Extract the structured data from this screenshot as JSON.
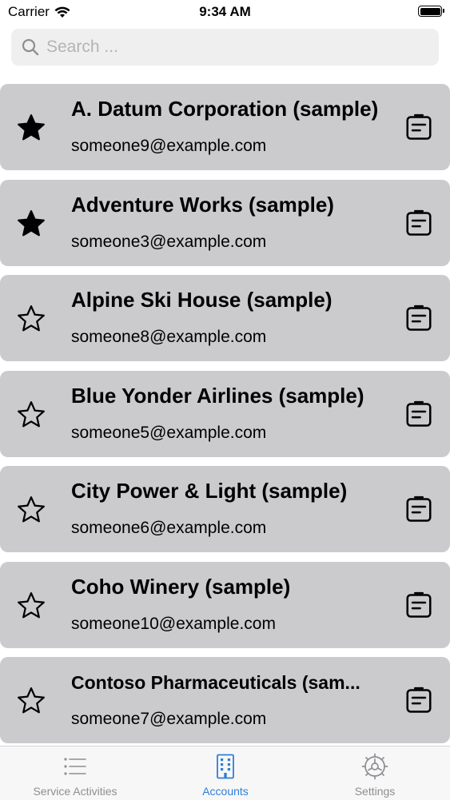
{
  "status_bar": {
    "carrier": "Carrier",
    "time": "9:34 AM",
    "battery_level": 1.0
  },
  "search": {
    "placeholder": "Search ..."
  },
  "accounts": [
    {
      "name": "A. Datum Corporation (sample)",
      "email": "someone9@example.com",
      "favorite": true
    },
    {
      "name": "Adventure Works (sample)",
      "email": "someone3@example.com",
      "favorite": true
    },
    {
      "name": "Alpine Ski House (sample)",
      "email": "someone8@example.com",
      "favorite": false
    },
    {
      "name": "Blue Yonder Airlines (sample)",
      "email": "someone5@example.com",
      "favorite": false
    },
    {
      "name": "City Power & Light (sample)",
      "email": "someone6@example.com",
      "favorite": false
    },
    {
      "name": "Coho Winery (sample)",
      "email": "someone10@example.com",
      "favorite": false
    },
    {
      "name": "Contoso Pharmaceuticals (sam...",
      "email": "someone7@example.com",
      "favorite": false
    }
  ],
  "tab_bar": {
    "tabs": [
      {
        "label": "Service Activities",
        "icon": "list-icon",
        "active": false
      },
      {
        "label": "Accounts",
        "icon": "building-icon",
        "active": true
      },
      {
        "label": "Settings",
        "icon": "gear-icon",
        "active": false
      }
    ]
  },
  "colors": {
    "card_bg": "#cbcacd",
    "accent": "#2f7ed8",
    "inactive_tab": "#8e8e93"
  }
}
